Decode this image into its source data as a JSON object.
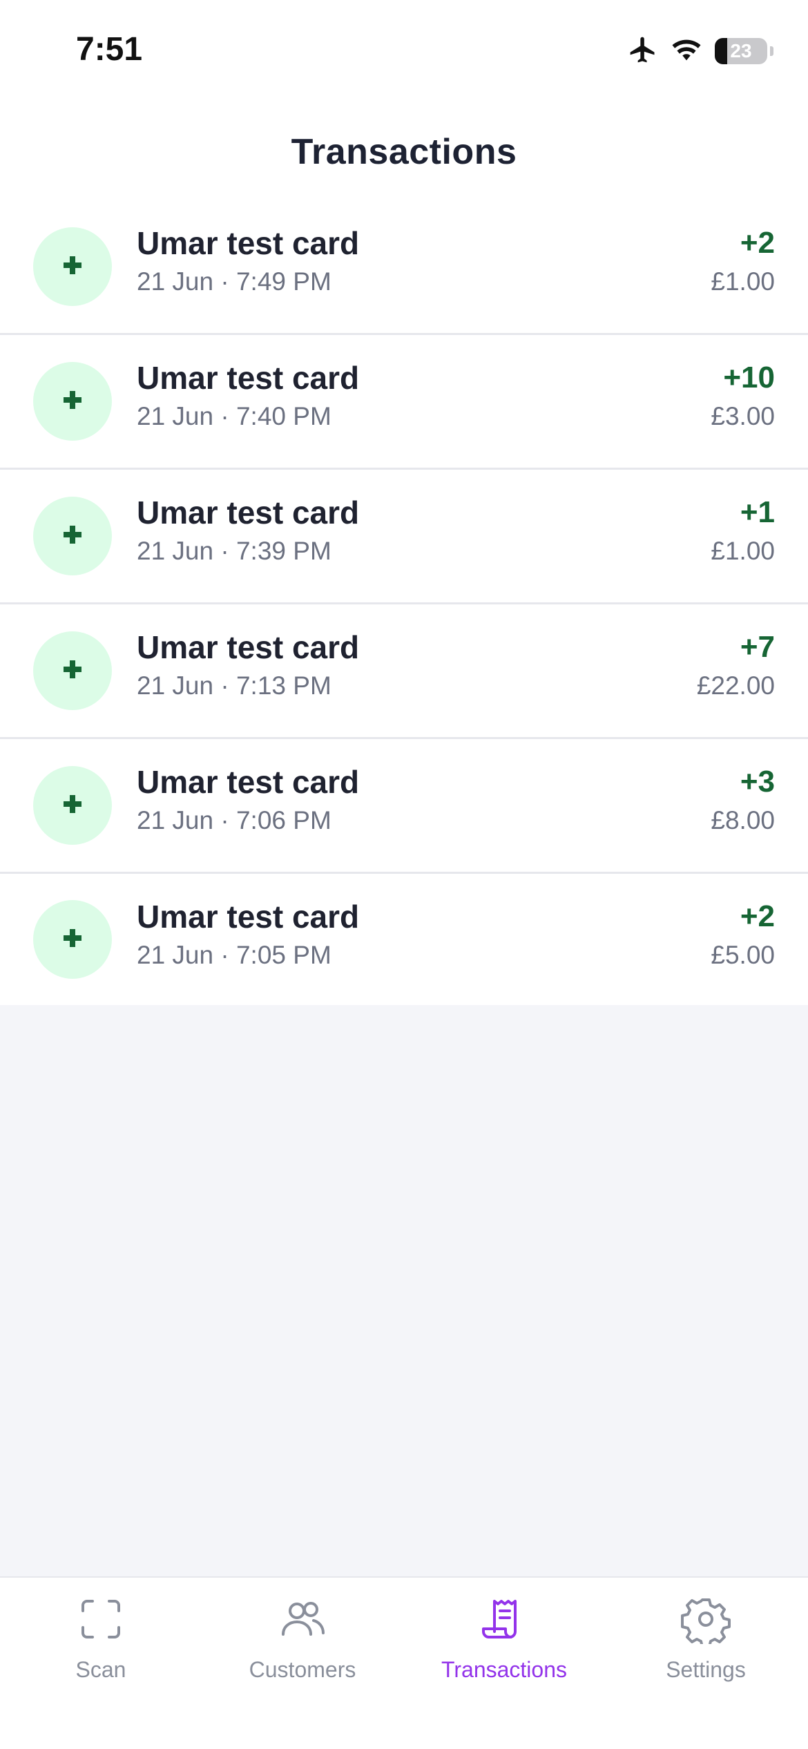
{
  "status_bar": {
    "time": "7:51",
    "battery": "23"
  },
  "header": {
    "title": "Transactions"
  },
  "transactions": [
    {
      "name": "Umar test card",
      "date": "21 Jun · 7:49 PM",
      "points": "+2",
      "amount": "£1.00"
    },
    {
      "name": "Umar test card",
      "date": "21 Jun · 7:40 PM",
      "points": "+10",
      "amount": "£3.00"
    },
    {
      "name": "Umar test card",
      "date": "21 Jun · 7:39 PM",
      "points": "+1",
      "amount": "£1.00"
    },
    {
      "name": "Umar test card",
      "date": "21 Jun · 7:13 PM",
      "points": "+7",
      "amount": "£22.00"
    },
    {
      "name": "Umar test card",
      "date": "21 Jun · 7:06 PM",
      "points": "+3",
      "amount": "£8.00"
    },
    {
      "name": "Umar test card",
      "date": "21 Jun · 7:05 PM",
      "points": "+2",
      "amount": "£5.00"
    }
  ],
  "tab_bar": {
    "items": [
      {
        "label": "Scan",
        "icon": "scan-icon",
        "active": false
      },
      {
        "label": "Customers",
        "icon": "users-icon",
        "active": false
      },
      {
        "label": "Transactions",
        "icon": "receipt-icon",
        "active": true
      },
      {
        "label": "Settings",
        "icon": "gear-icon",
        "active": false
      }
    ]
  },
  "colors": {
    "accent": "#9333ea",
    "positive": "#166534",
    "positive_bg": "#dcfce7",
    "inactive": "#8a8f9b"
  }
}
